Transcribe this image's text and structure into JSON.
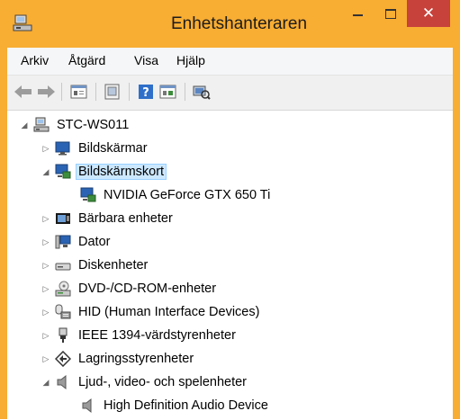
{
  "window": {
    "title": "Enhetshanteraren",
    "close_glyph": "✕",
    "accent_color": "#f8ad33",
    "close_color": "#c7423b"
  },
  "menu": [
    "Arkiv",
    "Åtgärd",
    "Visa",
    "Hjälp"
  ],
  "toolbar": {
    "tools": [
      "back-arrow-icon",
      "forward-arrow-icon",
      "properties-icon",
      "update-icon",
      "help-icon",
      "view-icon",
      "scan-hardware-icon"
    ]
  },
  "tree": {
    "root": "STC-WS011",
    "items": [
      {
        "label": "Bildskärmar",
        "icon": "monitor-icon",
        "state": "collapsed"
      },
      {
        "label": "Bildskärmskort",
        "icon": "display-adapter-icon",
        "state": "expanded",
        "selected": true
      },
      {
        "label": "NVIDIA GeForce GTX 650 Ti",
        "icon": "display-adapter-icon",
        "state": "leaf"
      },
      {
        "label": "Bärbara enheter",
        "icon": "portable-device-icon",
        "state": "collapsed"
      },
      {
        "label": "Dator",
        "icon": "computer-icon",
        "state": "collapsed"
      },
      {
        "label": "Diskenheter",
        "icon": "disk-drive-icon",
        "state": "collapsed"
      },
      {
        "label": "DVD-/CD-ROM-enheter",
        "icon": "dvd-drive-icon",
        "state": "collapsed"
      },
      {
        "label": "HID (Human Interface Devices)",
        "icon": "hid-icon",
        "state": "collapsed"
      },
      {
        "label": "IEEE 1394-värdstyrenheter",
        "icon": "ieee1394-icon",
        "state": "collapsed"
      },
      {
        "label": "Lagringsstyrenheter",
        "icon": "storage-controller-icon",
        "state": "collapsed"
      },
      {
        "label": "Ljud-, video- och spelenheter",
        "icon": "speaker-icon",
        "state": "expanded"
      },
      {
        "label": "High Definition Audio Device",
        "icon": "speaker-icon",
        "state": "leaf"
      }
    ]
  }
}
